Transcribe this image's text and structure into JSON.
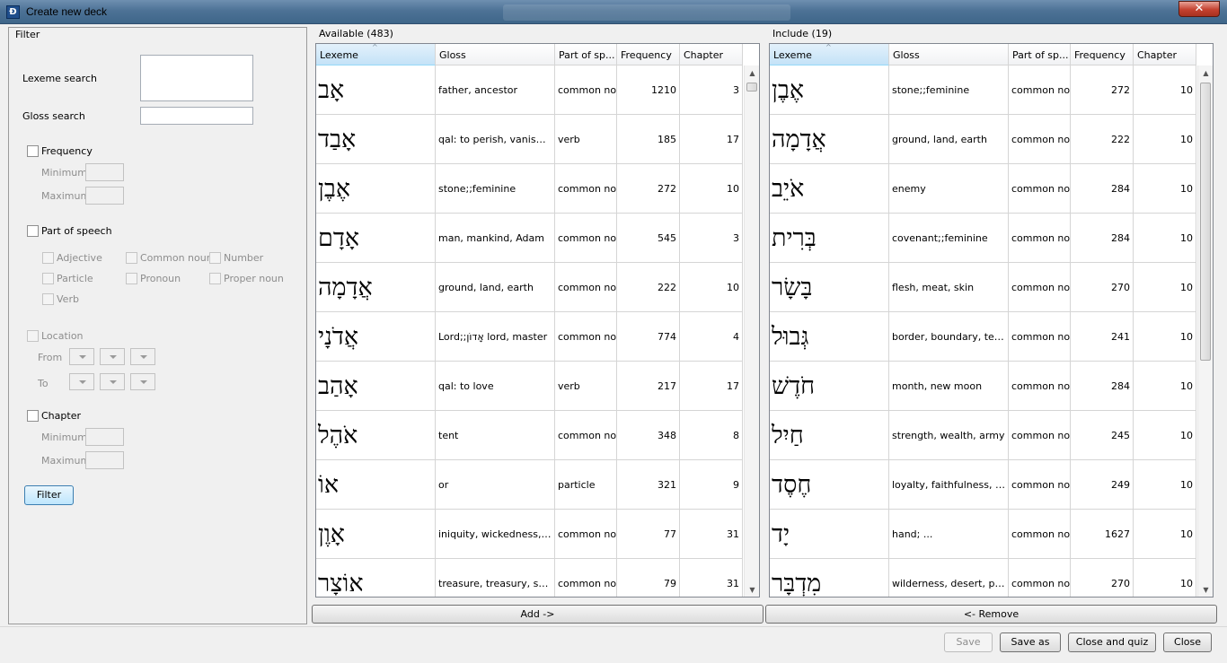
{
  "window": {
    "title": "Create new deck",
    "close_glyph": "✕"
  },
  "filter": {
    "legend": "Filter",
    "lexeme_search_label": "Lexeme search",
    "gloss_search_label": "Gloss search",
    "frequency_label": "Frequency",
    "minimum_label": "Minimum",
    "maximum_label": "Maximum",
    "pos_label": "Part of speech",
    "pos_options": [
      "Adjective",
      "Common noun",
      "Number",
      "Particle",
      "Pronoun",
      "Proper noun",
      "Verb"
    ],
    "location_label": "Location",
    "from_label": "From",
    "to_label": "To",
    "chapter_label": "Chapter",
    "filter_button": "Filter"
  },
  "available": {
    "caption": "Available (483)",
    "columns": [
      "Lexeme",
      "Gloss",
      "Part of sp...",
      "Frequency",
      "Chapter"
    ],
    "rows": [
      {
        "lexeme": "אָב",
        "gloss": "father, ancestor",
        "pos": "common noun",
        "frequency": "1210",
        "chapter": "3"
      },
      {
        "lexeme": "אָבַד",
        "gloss": "qal: to perish, vanish, b...",
        "pos": "verb",
        "frequency": "185",
        "chapter": "17"
      },
      {
        "lexeme": "אֶבֶן",
        "gloss": "stone;;feminine",
        "pos": "common noun",
        "frequency": "272",
        "chapter": "10"
      },
      {
        "lexeme": "אָדָם",
        "gloss": "man, mankind, Adam",
        "pos": "common noun",
        "frequency": "545",
        "chapter": "3"
      },
      {
        "lexeme": "אֲדָמָה",
        "gloss": "ground, land, earth",
        "pos": "common noun",
        "frequency": "222",
        "chapter": "10"
      },
      {
        "lexeme": "אֲדֹנָי",
        "gloss": "Lord;;אָדוֹן lord, master",
        "pos": "common noun",
        "frequency": "774",
        "chapter": "4"
      },
      {
        "lexeme": "אָהַב",
        "gloss": "qal: to love",
        "pos": "verb",
        "frequency": "217",
        "chapter": "17"
      },
      {
        "lexeme": "אֹהֶל",
        "gloss": "tent",
        "pos": "common noun",
        "frequency": "348",
        "chapter": "8"
      },
      {
        "lexeme": "אוֹ",
        "gloss": "or",
        "pos": "particle",
        "frequency": "321",
        "chapter": "9"
      },
      {
        "lexeme": "אָוֶן",
        "gloss": "iniquity, wickedness, evil...",
        "pos": "common noun",
        "frequency": "77",
        "chapter": "31"
      },
      {
        "lexeme": "אוֹצָר",
        "gloss": "treasure, treasury, stor...",
        "pos": "common noun",
        "frequency": "79",
        "chapter": "31"
      }
    ]
  },
  "include": {
    "caption": "Include (19)",
    "columns": [
      "Lexeme",
      "Gloss",
      "Part of sp...",
      "Frequency",
      "Chapter"
    ],
    "rows": [
      {
        "lexeme": "אֶבֶן",
        "gloss": "stone;;feminine",
        "pos": "common noun",
        "frequency": "272",
        "chapter": "10"
      },
      {
        "lexeme": "אֲדָמָה",
        "gloss": "ground, land, earth",
        "pos": "common noun",
        "frequency": "222",
        "chapter": "10"
      },
      {
        "lexeme": "אֹיֵב",
        "gloss": "enemy",
        "pos": "common noun",
        "frequency": "284",
        "chapter": "10"
      },
      {
        "lexeme": "בְּרִית",
        "gloss": "covenant;;feminine",
        "pos": "common noun",
        "frequency": "284",
        "chapter": "10"
      },
      {
        "lexeme": "בָּשָׂר",
        "gloss": "flesh, meat, skin",
        "pos": "common noun",
        "frequency": "270",
        "chapter": "10"
      },
      {
        "lexeme": "גְּבוּל",
        "gloss": "border, boundary, territ...",
        "pos": "common noun",
        "frequency": "241",
        "chapter": "10"
      },
      {
        "lexeme": "חֹדֶשׁ",
        "gloss": "month, new moon",
        "pos": "common noun",
        "frequency": "284",
        "chapter": "10"
      },
      {
        "lexeme": "חַיִל",
        "gloss": "strength, wealth, army",
        "pos": "common noun",
        "frequency": "245",
        "chapter": "10"
      },
      {
        "lexeme": "חֶסֶד",
        "gloss": "loyalty, faithfulness, ste...",
        "pos": "common noun",
        "frequency": "249",
        "chapter": "10"
      },
      {
        "lexeme": "יָד",
        "gloss": "hand; ...",
        "pos": "common noun",
        "frequency": "1627",
        "chapter": "10"
      },
      {
        "lexeme": "מִדְבָּר",
        "gloss": "wilderness, desert, past...",
        "pos": "common noun",
        "frequency": "270",
        "chapter": "10"
      }
    ]
  },
  "actions": {
    "add": "Add ->",
    "remove": "<- Remove",
    "save": "Save",
    "save_as": "Save as",
    "close_and_quiz": "Close and quiz",
    "close": "Close"
  }
}
